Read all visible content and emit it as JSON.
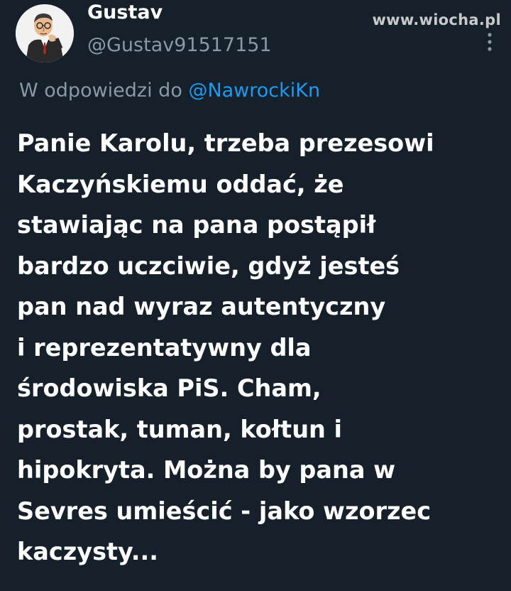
{
  "watermark": {
    "text": "www.wiocha.pl"
  },
  "author": {
    "name": "Gustav",
    "handle": "@Gustav91517151",
    "avatar_icon": "cartoon-thinking-man-avatar"
  },
  "more_icon": "ellipsis-vertical-icon",
  "reply": {
    "prefix": "W odpowiedzi do",
    "mention": "@NawrockiKn"
  },
  "tweet": {
    "lines": [
      "Panie Karolu, trzeba prezesowi",
      "Kaczyńskiemu oddać, że",
      "stawiając na pana postąpił",
      "bardzo uczciwie, gdyż jesteś",
      "pan nad wyraz autentyczny",
      "i reprezentatywny dla",
      "środowiska PiS. Cham,",
      "prostak, tuman, kołtun i",
      "hipokryta. Można by pana w",
      "Sevres umieścić - jako wzorzec",
      "kaczysty..."
    ]
  },
  "colors": {
    "background": "#15202b",
    "text_primary": "#ffffff",
    "text_secondary": "#8b98a5",
    "link": "#1d9bf0"
  }
}
